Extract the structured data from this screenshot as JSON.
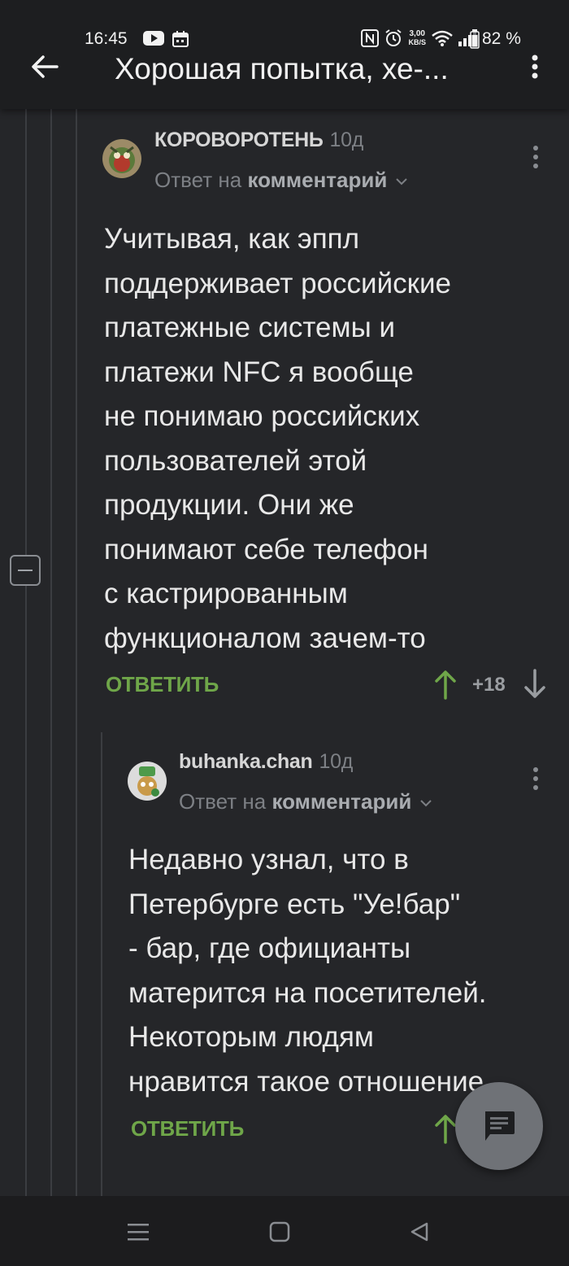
{
  "status_bar": {
    "time": "16:45",
    "speed_value": "3,00",
    "speed_unit": "KB/S",
    "battery": "82 %"
  },
  "app_bar": {
    "title": "Хорошая попытка, хе-..."
  },
  "comments": [
    {
      "author": "КОРОВОРОТЕНЬ",
      "age": "10д",
      "reply_prefix": "Ответ на",
      "reply_target": "комментарий",
      "body_lines": [
        "Учитывая, как эппл",
        "поддерживает российские",
        "платежные системы и",
        "платежи NFC я вообще",
        "не понимаю российских",
        "пользователей этой",
        "продукции. Они же",
        "понимают себе телефон",
        "с кастрированным",
        "функционалом зачем-то"
      ],
      "reply_label": "ОТВЕТИТЬ",
      "score": "+18"
    },
    {
      "author": "buhanka.chan",
      "age": "10д",
      "reply_prefix": "Ответ на",
      "reply_target": "комментарий",
      "body_lines": [
        "Недавно узнал, что в",
        "Петербурге есть \"Уе!бар\"",
        "- бар, где официанты",
        "материтcя на посетителей.",
        "Некоторым людям",
        "нравится такое отношение."
      ],
      "reply_label": "ОТВЕТИТЬ"
    }
  ],
  "colors": {
    "background": "#252629",
    "app_bar": "#1d1e20",
    "accent_green": "#6fa649",
    "muted_text": "#7d8085"
  },
  "icons": [
    "youtube-icon",
    "calendar-icon",
    "nfc-icon",
    "alarm-icon",
    "wifi-icon",
    "signal-icon",
    "battery-icon",
    "back-arrow-icon",
    "more-vertical-icon",
    "collapse-minus-icon",
    "arrow-up-icon",
    "arrow-down-icon",
    "chat-icon",
    "nav-menu-icon",
    "nav-home-icon",
    "nav-back-icon"
  ]
}
